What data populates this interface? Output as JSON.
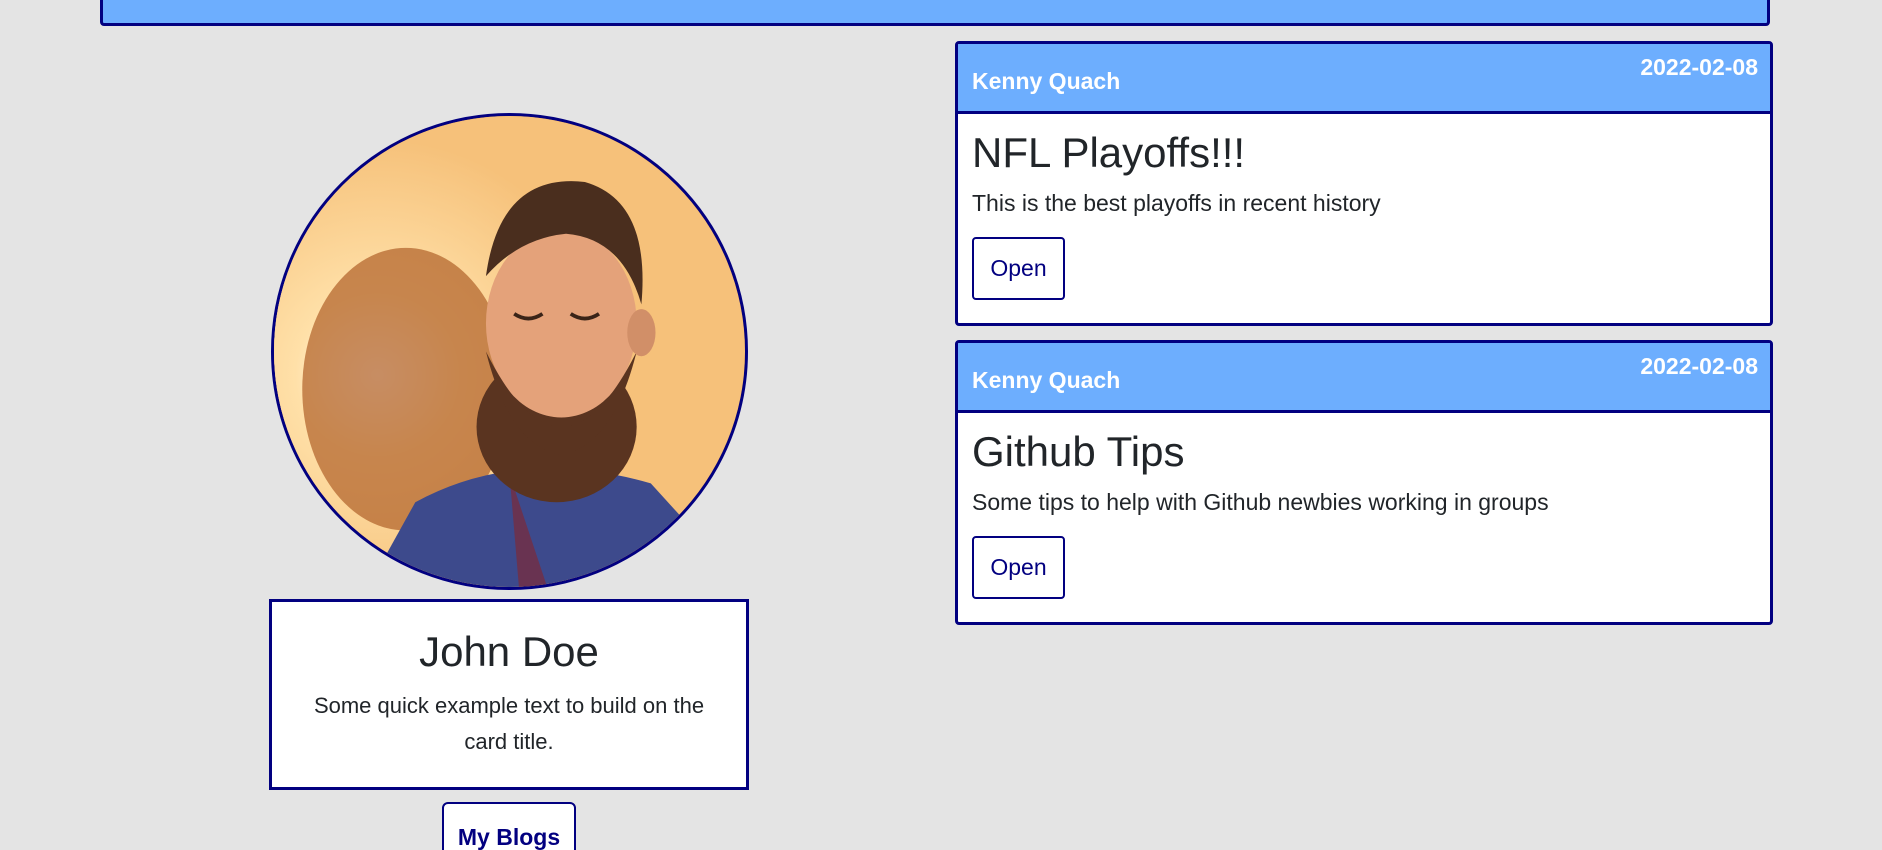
{
  "profile": {
    "name": "John Doe",
    "text": "Some quick example text to build on the card title.",
    "button_label": "My Blogs"
  },
  "blogs": [
    {
      "author": "Kenny Quach",
      "date": "2022-02-08",
      "title": "NFL Playoffs!!!",
      "text": "This is the best playoffs in recent history",
      "button_label": "Open"
    },
    {
      "author": "Kenny Quach",
      "date": "2022-02-08",
      "title": "Github Tips",
      "text": "Some tips to help with Github newbies working in groups",
      "button_label": "Open"
    }
  ],
  "colors": {
    "accent": "#6daefe",
    "border": "#020080",
    "background": "#e4e4e4"
  }
}
